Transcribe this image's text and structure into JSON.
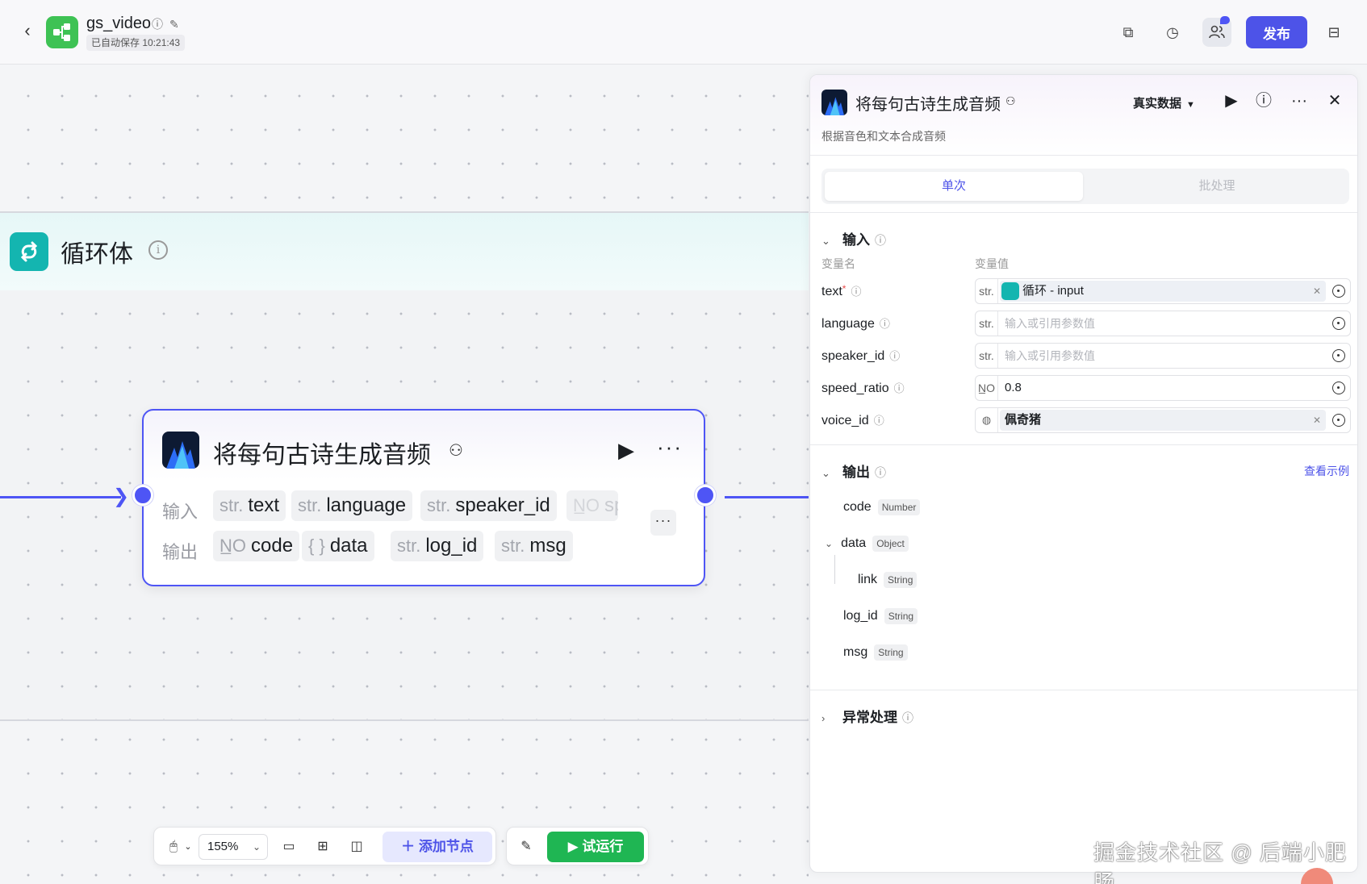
{
  "header": {
    "app_name": "gs_video",
    "autosave": "已自动保存 10:21:43",
    "publish_label": "发布"
  },
  "canvas": {
    "loop_title": "循环体",
    "node": {
      "title": "将每句古诗生成音频",
      "input_label": "输入",
      "output_label": "输出",
      "inputs": [
        {
          "type": "str.",
          "name": "text"
        },
        {
          "type": "str.",
          "name": "language"
        },
        {
          "type": "str.",
          "name": "speaker_id"
        },
        {
          "type": "N̲O",
          "name": "sp"
        }
      ],
      "outputs": [
        {
          "type": "N̲O",
          "name": "code"
        },
        {
          "type": "{ }",
          "name": "data"
        },
        {
          "type": "str.",
          "name": "log_id"
        },
        {
          "type": "str.",
          "name": "msg"
        }
      ]
    }
  },
  "toolbar": {
    "zoom": "155%",
    "add_node_label": "添加节点",
    "test_run_label": "试运行"
  },
  "panel": {
    "title": "将每句古诗生成音频",
    "data_select": "真实数据",
    "description": "根据音色和文本合成音频",
    "tabs": {
      "single": "单次",
      "batch": "批处理"
    },
    "input_section": "输入",
    "col_var_name": "变量名",
    "col_var_value": "变量值",
    "fields": [
      {
        "name": "text",
        "type": "str.",
        "ref_label": "循环 - input"
      },
      {
        "name": "language",
        "type": "str.",
        "placeholder": "输入或引用参数值"
      },
      {
        "name": "speaker_id",
        "type": "str.",
        "placeholder": "输入或引用参数值"
      },
      {
        "name": "speed_ratio",
        "type": "N̲O",
        "value": "0.8"
      },
      {
        "name": "voice_id",
        "value": "佩奇猪"
      }
    ],
    "output_section": "输出",
    "see_example": "查看示例",
    "outputs": [
      {
        "name": "code",
        "type": "Number"
      },
      {
        "name": "data",
        "type": "Object"
      },
      {
        "name": "link",
        "type": "String"
      },
      {
        "name": "log_id",
        "type": "String"
      },
      {
        "name": "msg",
        "type": "String"
      }
    ],
    "exception_section": "异常处理"
  },
  "watermark": "掘金技术社区 @ 后端小肥肠",
  "colors": {
    "accent": "#4d53e8",
    "run_green": "#1fb653",
    "loop_teal": "#14b5b0",
    "edge": "#4e55f5"
  }
}
